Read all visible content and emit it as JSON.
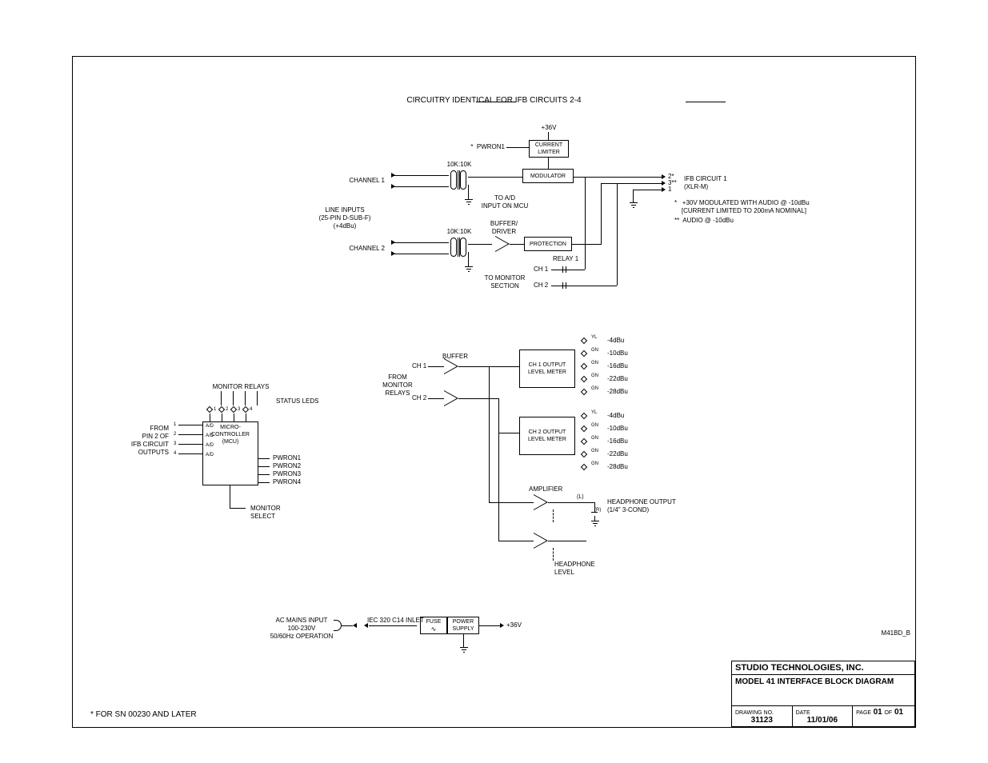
{
  "notes": {
    "top": "CIRCUITRY IDENTICAL FOR IFB CIRCUITS 2-4",
    "sn": "* FOR SN 00230 AND LATER",
    "docCode": "M41BD_B"
  },
  "titleblock": {
    "company": "STUDIO TECHNOLOGIES, INC.",
    "model": "MODEL 41 INTERFACE\nBLOCK DIAGRAM",
    "drawingNoLabel": "DRAWING NO.",
    "drawingNo": "31123",
    "dateLabel": "DATE",
    "date": "11/01/06",
    "pageLabel": "PAGE",
    "page": "01",
    "pageOf": "OF",
    "pageTotal": "01"
  },
  "section1": {
    "plus36v": "+36V",
    "pwron1": "*  PWRON1",
    "currentLimiter": "CURRENT\nLIMITER",
    "modulator": "MODULATOR",
    "channel1": "CHANNEL 1",
    "channel2": "CHANNEL 2",
    "ratio": "10K:10K",
    "lineInputs": "LINE INPUTS\n(25-PIN D-SUB-F)\n(+4dBu)",
    "toADMCU": "TO A/D\nINPUT ON MCU",
    "bufferDriver": "BUFFER/\nDRIVER",
    "protection": "PROTECTION",
    "toMonitor": "TO MONITOR\nSECTION",
    "relay1": "RELAY 1",
    "ch1": "CH 1",
    "ch2": "CH 2",
    "ifbOut": "IFB CIRCUIT 1\n(XLR-M)",
    "pin2": "2*",
    "pin3": "3**",
    "pin1": "1",
    "note1": "*   +30V MODULATED WITH AUDIO @ -10dBu\n    [CURRENT LIMITED TO 200mA NOMINAL]",
    "note2": "**  AUDIO @ -10dBu"
  },
  "section2": {
    "monitorRelaysTop": "MONITOR RELAYS",
    "statusLeds": "STATUS LEDS",
    "ledLabels": [
      "1",
      "2",
      "3",
      "4"
    ],
    "from": "FROM\nPIN 2 OF\nIFB CIRCUIT\nOUTPUTS",
    "adItems": [
      "A/D",
      "A/D",
      "A/D",
      "A/D"
    ],
    "lineNos": [
      "1",
      "2",
      "3",
      "4"
    ],
    "mcu": "MICRO-\nCONTROLLER\n(MCU)",
    "pwron": [
      "PWRON1",
      "PWRON2",
      "PWRON3",
      "PWRON4"
    ],
    "monitorSelect": "MONITOR\nSELECT",
    "buffer": "BUFFER",
    "fromMonitorRelays": "FROM\nMONITOR\nRELAYS",
    "ch1": "CH 1",
    "ch2": "CH 2",
    "meter1": "CH 1\nOUTPUT\nLEVEL METER",
    "meter2": "CH 2\nOUTPUT\nLEVEL METER",
    "levels": [
      "-4dBu",
      "-10dBu",
      "-16dBu",
      "-22dBu",
      "-28dBu"
    ],
    "ledColors1": [
      "YL",
      "GN",
      "GN",
      "GN",
      "GN"
    ],
    "amplifier": "AMPLIFIER",
    "headphoneOut": "HEADPHONE OUTPUT\n(1/4\" 3-COND)",
    "headphoneLevel": "HEADPHONE\nLEVEL",
    "L": "(L)",
    "R": "(R)"
  },
  "section3": {
    "mains": "AC MAINS INPUT\n100-230V\n50/60Hz OPERATION",
    "iec": "IEC 320 C14 INLET",
    "fuse": "FUSE",
    "psu": "POWER\nSUPPLY",
    "plus36v": "+36V"
  }
}
